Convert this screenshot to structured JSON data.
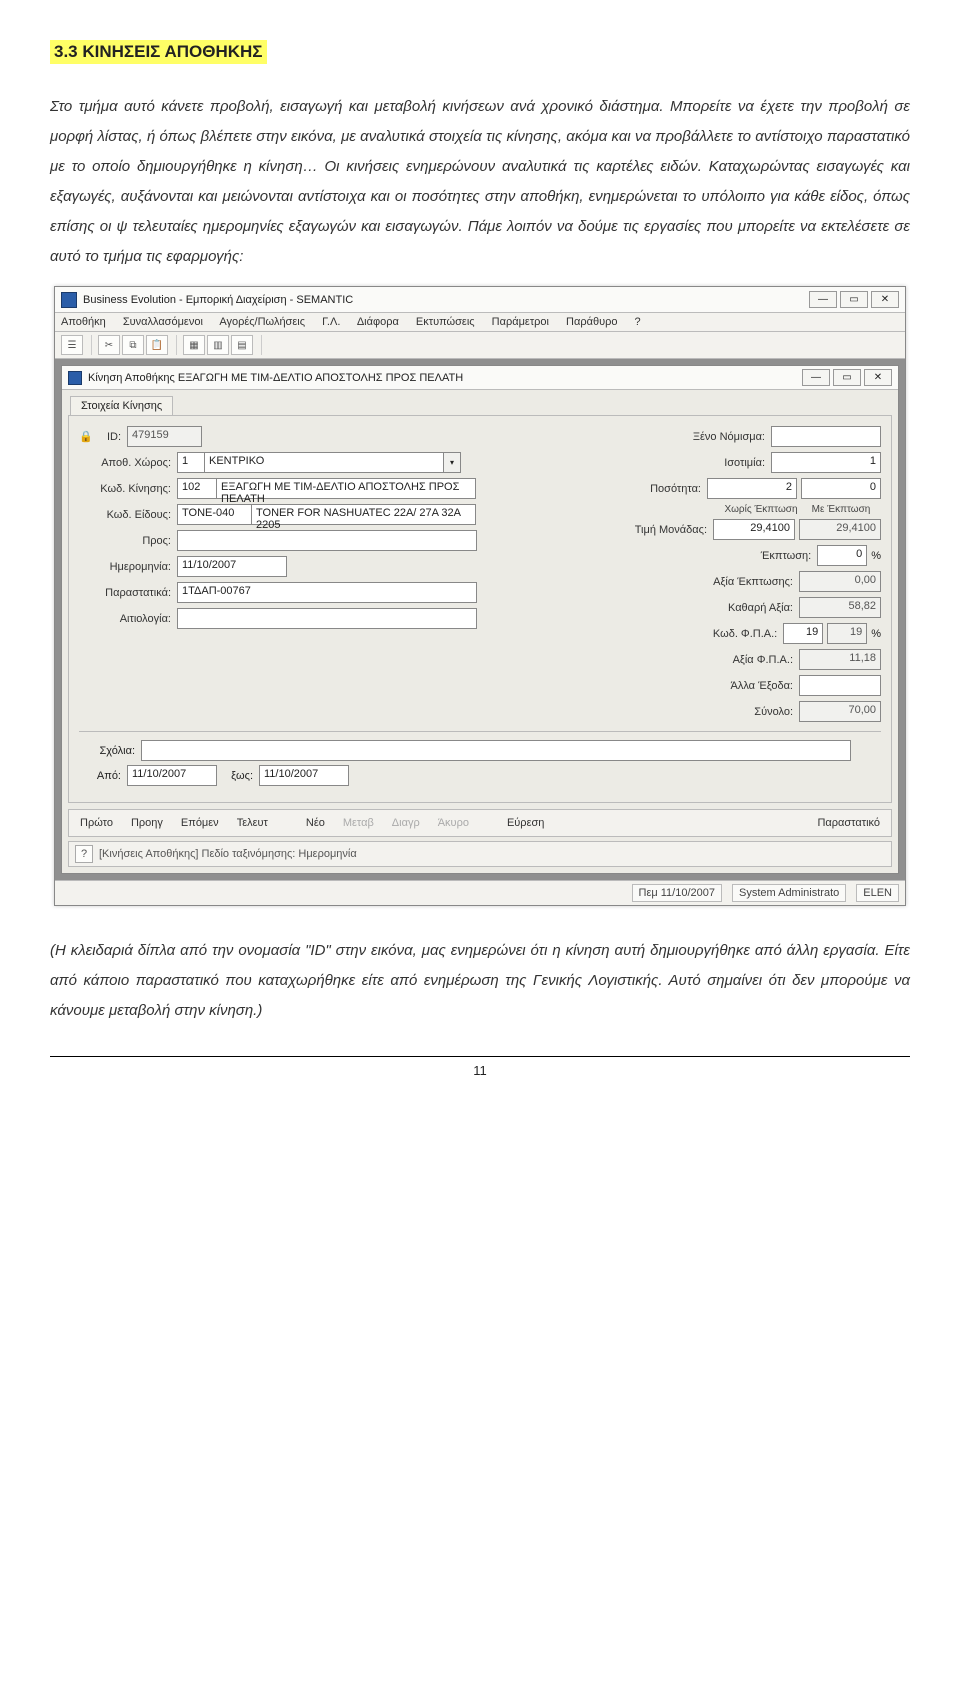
{
  "heading": "3.3 ΚΙΝΗΣΕΙΣ ΑΠΟΘΗΚΗΣ",
  "para1": "Στο τμήμα αυτό κάνετε προβολή, εισαγωγή και μεταβολή κινήσεων ανά χρονικό διάστημα. Μπορείτε να έχετε την προβολή σε μορφή λίστας, ή όπως βλέπετε στην εικόνα, με αναλυτικά στοιχεία τις κίνησης, ακόμα και να προβάλλετε το αντίστοιχο παραστατικό με το οποίο δημιουργήθηκε η κίνηση… Οι κινήσεις ενημερώνουν αναλυτικά τις καρτέλες ειδών. Καταχωρώντας εισαγωγές και εξαγωγές, αυξάνονται και μειώνονται αντίστοιχα και οι ποσότητες στην αποθήκη, ενημερώνεται το υπόλοιπο για κάθε είδος, όπως επίσης οι ψ τελευταίες ημερομηνίες εξαγωγών και εισαγωγών. Πάμε λοιπόν να δούμε τις εργασίες που μπορείτε να εκτελέσετε σε αυτό το τμήμα τις εφαρμογής:",
  "para2": "(Η κλειδαριά δίπλα από την ονομασία \"ID\" στην εικόνα, μας ενημερώνει ότι η κίνηση αυτή δημιουργήθηκε από άλλη εργασία. Είτε από κάποιο παραστατικό που καταχωρήθηκε είτε από ενημέρωση της Γενικής Λογιστικής. Αυτό σημαίνει ότι δεν μπορούμε να κάνουμε μεταβολή στην κίνηση.)",
  "page_number": "11",
  "app": {
    "title": "Business Evolution - Εμπορική Διαχείριση - SEMANTIC",
    "menus": [
      "Αποθήκη",
      "Συναλλασόμενοι",
      "Αγορές/Πωλήσεις",
      "Γ.Λ.",
      "Διάφορα",
      "Εκτυπώσεις",
      "Παράμετροι",
      "Παράθυρο",
      "?"
    ],
    "inner_title": "Κίνηση Αποθήκης ΕΞΑΓΩΓΗ ΜΕ ΤΙΜ-ΔΕΛΤΙΟ ΑΠΟΣΤΟΛΗΣ ΠΡΟΣ ΠΕΛΑΤΗ",
    "tab": "Στοιχεία Κίνησης",
    "labels": {
      "id": "ID:",
      "apoth": "Αποθ. Χώρος:",
      "kod_kin": "Κωδ. Κίνησης:",
      "kod_eid": "Κωδ. Είδους:",
      "pros": "Προς:",
      "date": "Ημερομηνία:",
      "parast": "Παραστατικά:",
      "aitiol": "Αιτιολογία:",
      "xeno": "Ξένο Νόμισμα:",
      "isot": "Ισοτιμία:",
      "posot": "Ποσότητα:",
      "col_no_disc": "Χωρίς Έκπτωση",
      "col_disc": "Με Έκπτωση",
      "timi": "Τιμή Μονάδας:",
      "ekpt": "Έκπτωση:",
      "aksia_ekpt": "Αξία Έκπτωσης:",
      "kathara": "Καθαρή Αξία:",
      "kod_fpa": "Κωδ. Φ.Π.Α.:",
      "aksia_fpa": "Αξία Φ.Π.Α.:",
      "alla": "Άλλα Έξοδα:",
      "synolo": "Σύνολο:",
      "sxolia": "Σχόλια:",
      "apo": "Από:",
      "eos": "ξως:",
      "pct": "%"
    },
    "values": {
      "id": "479159",
      "apoth_code": "1",
      "apoth_desc": "ΚΕΝΤΡΙΚΟ",
      "kin_code": "102",
      "kin_desc": "ΕΞΑΓΩΓΗ ΜΕ ΤΙΜ-ΔΕΛΤΙΟ ΑΠΟΣΤΟΛΗΣ ΠΡΟΣ ΠΕΛΑΤΗ",
      "eid_code": "TONE-040",
      "eid_desc": "TONER FOR NASHUATEC 22A/ 27A 32A 2205",
      "pros": "",
      "date": "11/10/2007",
      "parast": "1ΤΔΑΠ-00767",
      "aitiol": "",
      "xeno": "",
      "isot": "1",
      "posot_a": "2",
      "posot_b": "0",
      "timi_a": "29,4100",
      "timi_b": "29,4100",
      "ekpt": "0",
      "aksia_ekpt": "0,00",
      "kathara": "58,82",
      "fpa_code": "19",
      "fpa_pct": "19",
      "aksia_fpa": "11,18",
      "alla": "",
      "synolo": "70,00",
      "sxolia": "",
      "apo": "11/10/2007",
      "eos": "11/10/2007"
    },
    "nav": {
      "first": "Πρώτο",
      "prev": "Προηγ",
      "next": "Επόμεν",
      "last": "Τελευτ",
      "neo": "Νέο",
      "metab": "Μεταβ",
      "diagr": "Διαγρ",
      "akyro": "Άκυρο",
      "find": "Εύρεση",
      "parast": "Παραστατικό"
    },
    "status": "[Κινήσεις Αποθήκης] Πεδίο ταξινόμησης: Ημερομηνία",
    "outer_date": "Πεμ 11/10/2007",
    "outer_user": "System Administrato",
    "outer_co": "ELEN"
  }
}
